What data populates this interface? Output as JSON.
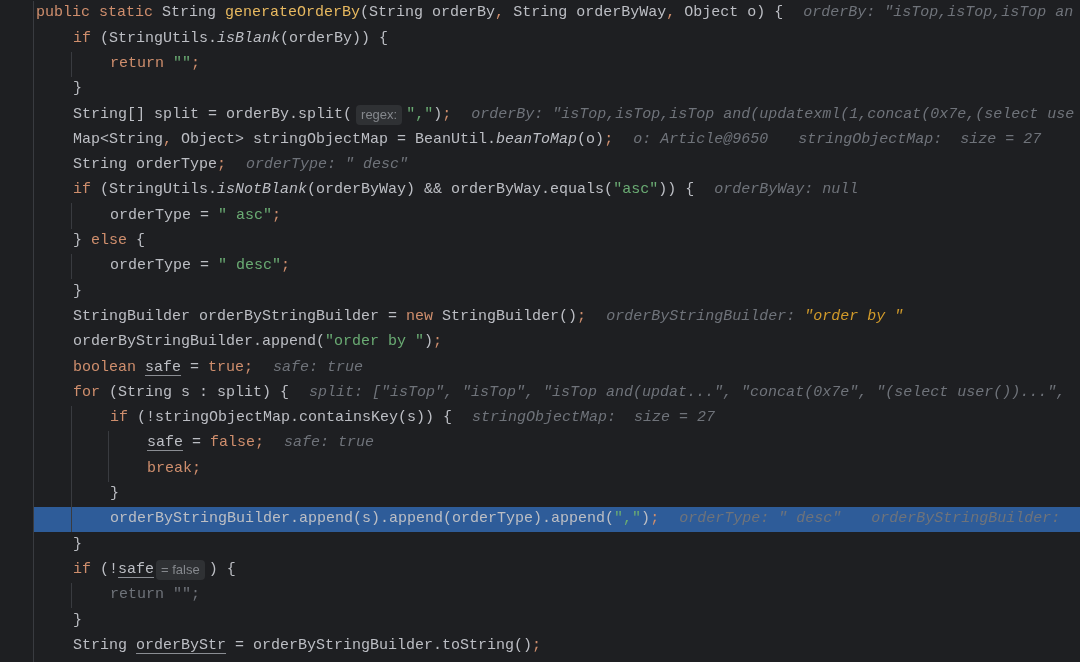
{
  "lines": [
    {
      "highlighted": false,
      "code": [
        {
          "kind": "keyword",
          "text": "public static "
        },
        {
          "kind": "plain",
          "text": "String "
        },
        {
          "kind": "declaration",
          "text": "generateOrderBy"
        },
        {
          "kind": "plain",
          "text": "(String orderBy"
        },
        {
          "kind": "punct",
          "text": ", "
        },
        {
          "kind": "plain",
          "text": "String orderByWay"
        },
        {
          "kind": "punct",
          "text": ", "
        },
        {
          "kind": "plain",
          "text": "Object o) {"
        }
      ],
      "hints": [
        [
          {
            "kind": "plain",
            "text": "orderBy: \"isTop,isTop,isTop an"
          }
        ]
      ],
      "children": [
        {
          "highlighted": false,
          "code": [
            {
              "kind": "keyword",
              "text": "if "
            },
            {
              "kind": "plain",
              "text": "(StringUtils."
            },
            {
              "kind": "static",
              "text": "isBlank"
            },
            {
              "kind": "plain",
              "text": "(orderBy)) {"
            }
          ],
          "children": [
            {
              "highlighted": false,
              "code": [
                {
                  "kind": "keyword",
                  "text": "return "
                },
                {
                  "kind": "string",
                  "text": "\"\""
                },
                {
                  "kind": "punct",
                  "text": ";"
                }
              ]
            }
          ]
        },
        {
          "highlighted": false,
          "code": [
            {
              "kind": "plain",
              "text": "}"
            }
          ]
        },
        {
          "highlighted": false,
          "code": [
            {
              "kind": "plain",
              "text": "String[] split = orderBy.split("
            },
            {
              "kind": "param-chip",
              "text": "regex:"
            },
            {
              "kind": "string",
              "text": "\",\""
            },
            {
              "kind": "plain",
              "text": ")"
            },
            {
              "kind": "punct",
              "text": ";"
            }
          ],
          "hints": [
            [
              {
                "kind": "plain",
                "text": "orderBy: \"isTop,isTop,isTop and(updatexml(1,concat(0x7e,(select use"
              }
            ]
          ]
        },
        {
          "highlighted": false,
          "code": [
            {
              "kind": "plain",
              "text": "Map<String"
            },
            {
              "kind": "punct",
              "text": ", "
            },
            {
              "kind": "plain",
              "text": "Object> stringObjectMap = BeanUtil."
            },
            {
              "kind": "static",
              "text": "beanToMap"
            },
            {
              "kind": "plain",
              "text": "(o)"
            },
            {
              "kind": "punct",
              "text": ";"
            }
          ],
          "hints": [
            [
              {
                "kind": "plain",
                "text": "o: Article@9650"
              }
            ],
            [
              {
                "kind": "plain",
                "text": "stringObjectMap:  size = 27"
              }
            ]
          ]
        },
        {
          "highlighted": false,
          "code": [
            {
              "kind": "plain",
              "text": "String orderType"
            },
            {
              "kind": "punct",
              "text": ";"
            }
          ],
          "hints": [
            [
              {
                "kind": "plain",
                "text": "orderType: \" desc\""
              }
            ]
          ]
        },
        {
          "highlighted": false,
          "code": [
            {
              "kind": "keyword",
              "text": "if "
            },
            {
              "kind": "plain",
              "text": "(StringUtils."
            },
            {
              "kind": "static",
              "text": "isNotBlank"
            },
            {
              "kind": "plain",
              "text": "(orderByWay) && orderByWay.equals("
            },
            {
              "kind": "string",
              "text": "\"asc\""
            },
            {
              "kind": "plain",
              "text": ")) {"
            }
          ],
          "hints": [
            [
              {
                "kind": "plain",
                "text": "orderByWay: null"
              }
            ]
          ],
          "children": [
            {
              "highlighted": false,
              "code": [
                {
                  "kind": "plain",
                  "text": "orderType = "
                },
                {
                  "kind": "string",
                  "text": "\" asc\""
                },
                {
                  "kind": "punct",
                  "text": ";"
                }
              ]
            }
          ]
        },
        {
          "highlighted": false,
          "code": [
            {
              "kind": "plain",
              "text": "} "
            },
            {
              "kind": "keyword",
              "text": "else "
            },
            {
              "kind": "plain",
              "text": "{"
            }
          ],
          "children": [
            {
              "highlighted": false,
              "code": [
                {
                  "kind": "plain",
                  "text": "orderType = "
                },
                {
                  "kind": "string",
                  "text": "\" desc\""
                },
                {
                  "kind": "punct",
                  "text": ";"
                }
              ]
            }
          ]
        },
        {
          "highlighted": false,
          "code": [
            {
              "kind": "plain",
              "text": "}"
            }
          ]
        },
        {
          "highlighted": false,
          "code": [
            {
              "kind": "plain",
              "text": "StringBuilder orderByStringBuilder = "
            },
            {
              "kind": "keyword",
              "text": "new "
            },
            {
              "kind": "plain",
              "text": "StringBuilder()"
            },
            {
              "kind": "punct",
              "text": ";"
            }
          ],
          "hints": [
            [
              {
                "kind": "plain",
                "text": "orderByStringBuilder: "
              },
              {
                "kind": "string",
                "text": "\"order by \""
              }
            ]
          ]
        },
        {
          "highlighted": false,
          "code": [
            {
              "kind": "plain",
              "text": "orderByStringBuilder.append("
            },
            {
              "kind": "string",
              "text": "\"order by \""
            },
            {
              "kind": "plain",
              "text": ")"
            },
            {
              "kind": "punct",
              "text": ";"
            }
          ]
        },
        {
          "highlighted": false,
          "code": [
            {
              "kind": "keyword",
              "text": "boolean "
            },
            {
              "kind": "underlined",
              "text": "safe"
            },
            {
              "kind": "plain",
              "text": " = "
            },
            {
              "kind": "keyword",
              "text": "true;"
            }
          ],
          "hints": [
            [
              {
                "kind": "plain",
                "text": "safe: true"
              }
            ]
          ]
        },
        {
          "highlighted": false,
          "code": [
            {
              "kind": "keyword",
              "text": "for "
            },
            {
              "kind": "plain",
              "text": "(String s : split) {"
            }
          ],
          "hints": [
            [
              {
                "kind": "plain",
                "text": "split: [\"isTop\", \"isTop\", \"isTop and(updat...\", \"concat(0x7e\", \"(select user())...\","
              }
            ]
          ],
          "children": [
            {
              "highlighted": false,
              "code": [
                {
                  "kind": "keyword",
                  "text": "if "
                },
                {
                  "kind": "plain",
                  "text": "(!stringObjectMap.containsKey(s)) {"
                }
              ],
              "hints": [
                [
                  {
                    "kind": "plain",
                    "text": "stringObjectMap:  size = 27"
                  }
                ]
              ],
              "children": [
                {
                  "highlighted": false,
                  "code": [
                    {
                      "kind": "underlined",
                      "text": "safe"
                    },
                    {
                      "kind": "plain",
                      "text": " = "
                    },
                    {
                      "kind": "keyword",
                      "text": "false;"
                    }
                  ],
                  "hints": [
                    [
                      {
                        "kind": "plain",
                        "text": "safe: true"
                      }
                    ]
                  ]
                },
                {
                  "highlighted": false,
                  "code": [
                    {
                      "kind": "keyword",
                      "text": "break;"
                    }
                  ]
                }
              ]
            },
            {
              "highlighted": false,
              "code": [
                {
                  "kind": "plain",
                  "text": "}"
                }
              ]
            },
            {
              "highlighted": true,
              "code": [
                {
                  "kind": "plain",
                  "text": "orderByStringBuilder.append(s).append(orderType).append("
                },
                {
                  "kind": "string",
                  "text": "\",\""
                },
                {
                  "kind": "plain",
                  "text": ")"
                },
                {
                  "kind": "punct",
                  "text": ";"
                }
              ],
              "hints": [
                [
                  {
                    "kind": "plain",
                    "text": "orderType: \" desc\""
                  }
                ],
                [
                  {
                    "kind": "plain",
                    "text": "orderByStringBuilder:"
                  }
                ]
              ]
            }
          ]
        },
        {
          "highlighted": false,
          "code": [
            {
              "kind": "plain",
              "text": "}"
            }
          ]
        },
        {
          "highlighted": false,
          "code": [
            {
              "kind": "keyword",
              "text": "if "
            },
            {
              "kind": "plain",
              "text": "(!"
            },
            {
              "kind": "underlined",
              "text": "safe"
            },
            {
              "kind": "value-chip",
              "text": "= false"
            },
            {
              "kind": "plain",
              "text": ") {"
            }
          ],
          "children": [
            {
              "highlighted": false,
              "code": [
                {
                  "kind": "dim",
                  "text": "return \"\";"
                }
              ]
            }
          ]
        },
        {
          "highlighted": false,
          "code": [
            {
              "kind": "plain",
              "text": "}"
            }
          ]
        },
        {
          "highlighted": false,
          "code": [
            {
              "kind": "plain",
              "text": "String "
            },
            {
              "kind": "underlined",
              "text": "orderByStr"
            },
            {
              "kind": "plain",
              "text": " = orderByStringBuilder.toString()"
            },
            {
              "kind": "punct",
              "text": ";"
            }
          ]
        }
      ]
    }
  ]
}
